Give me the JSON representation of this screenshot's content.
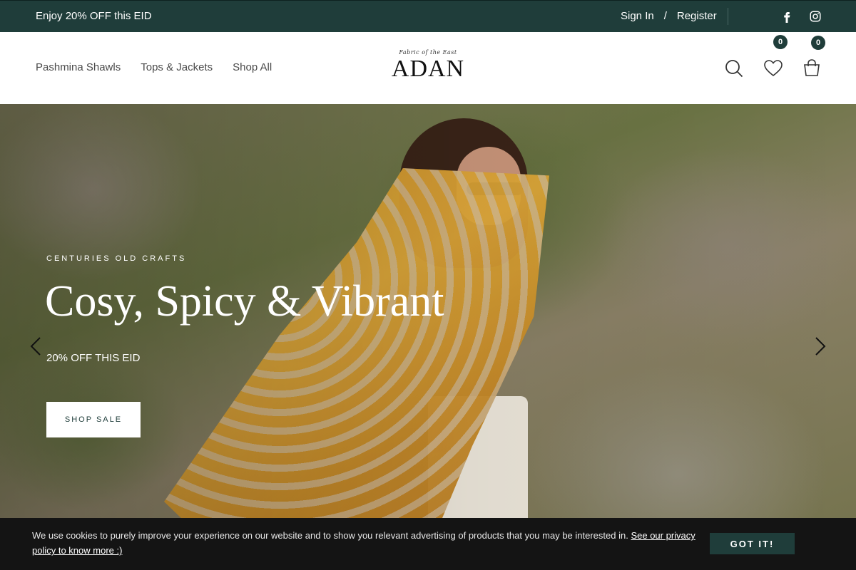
{
  "topbar": {
    "promo": "Enjoy 20% OFF this EID",
    "sign_in": "Sign In",
    "separator": "/",
    "register": "Register",
    "social_icons": [
      "facebook-icon",
      "instagram-icon"
    ]
  },
  "header": {
    "nav": [
      "Pashmina Shawls",
      "Tops & Jackets",
      "Shop All"
    ],
    "logo_tagline": "Fabric of the East",
    "logo_text": "ADAN",
    "icons": [
      "search-icon",
      "heart-icon",
      "cart-icon"
    ],
    "wishlist_count": "0",
    "cart_count": "0"
  },
  "hero": {
    "eyebrow": "CENTURIES OLD CRAFTS",
    "headline": "Cosy, Spicy & Vibrant",
    "subline": "20% OFF THIS EID",
    "cta": "SHOP SALE"
  },
  "cookie": {
    "message": "We use cookies to purely improve your experience on our website and to show you relevant advertising of products that you may be interested in.",
    "link": "See our privacy policy to know more :)",
    "button": "GOT IT!"
  },
  "colors": {
    "brand_dark": "#1f3d3a",
    "cookie_bg": "#141414"
  }
}
